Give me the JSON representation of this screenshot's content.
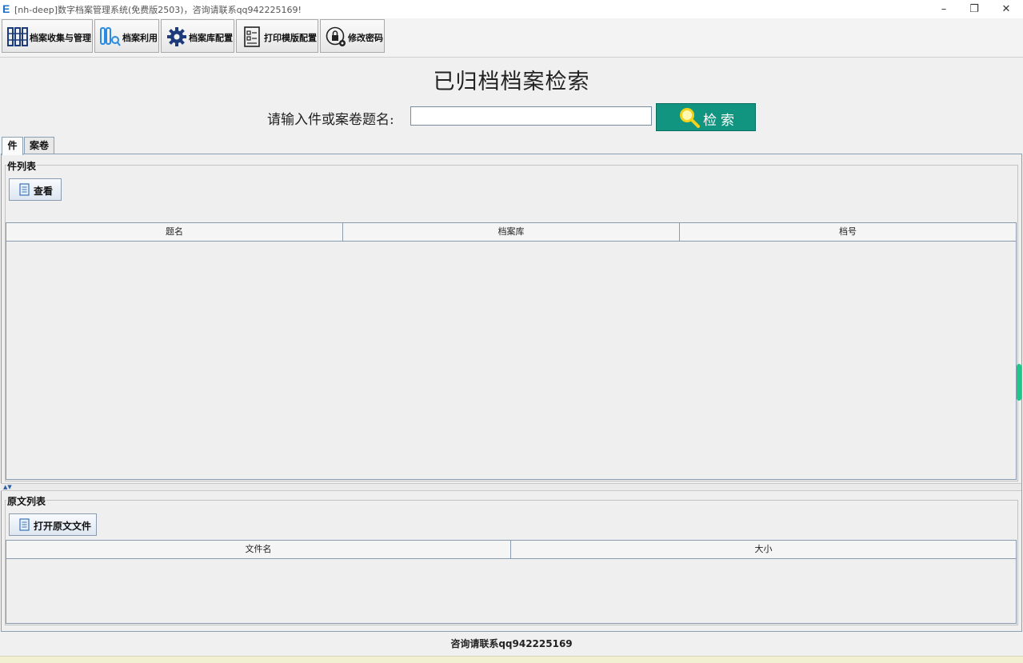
{
  "window": {
    "logo": "E",
    "title": "[nh-deep]数字档案管理系统(免费版2503)，咨询请联系qq942225169!",
    "controls": {
      "minimize": "–",
      "maximize": "❐",
      "close": "✕"
    }
  },
  "toolbar": {
    "items": [
      {
        "label": "档案收集与管理",
        "icon": "bookshelf-icon"
      },
      {
        "label": "档案利用",
        "icon": "archive-search-icon"
      },
      {
        "label": "档案库配置",
        "icon": "gear-icon"
      },
      {
        "label": "打印模版配置",
        "icon": "checklist-icon"
      },
      {
        "label": "修改密码",
        "icon": "lock-gear-icon"
      }
    ]
  },
  "main": {
    "title": "已归档档案检索",
    "search": {
      "label": "请输入件或案卷题名:",
      "value": "",
      "placeholder": "",
      "button_label": "检索",
      "button_icon": "magnifier-icon"
    },
    "tabs": [
      {
        "label": "件",
        "active": true
      },
      {
        "label": "案卷",
        "active": false
      }
    ],
    "item_list": {
      "title": "件列表",
      "view_button": "查看",
      "columns": [
        "题名",
        "档案库",
        "档号"
      ],
      "rows": []
    },
    "original_list": {
      "title": "原文列表",
      "open_button": "打开原文文件",
      "columns": [
        "文件名",
        "大小"
      ],
      "rows": []
    }
  },
  "status": {
    "text": "咨询请联系qq942225169"
  },
  "colors": {
    "accent": "#119580",
    "border": "#8ca0b4",
    "logo": "#1c6fc4"
  }
}
